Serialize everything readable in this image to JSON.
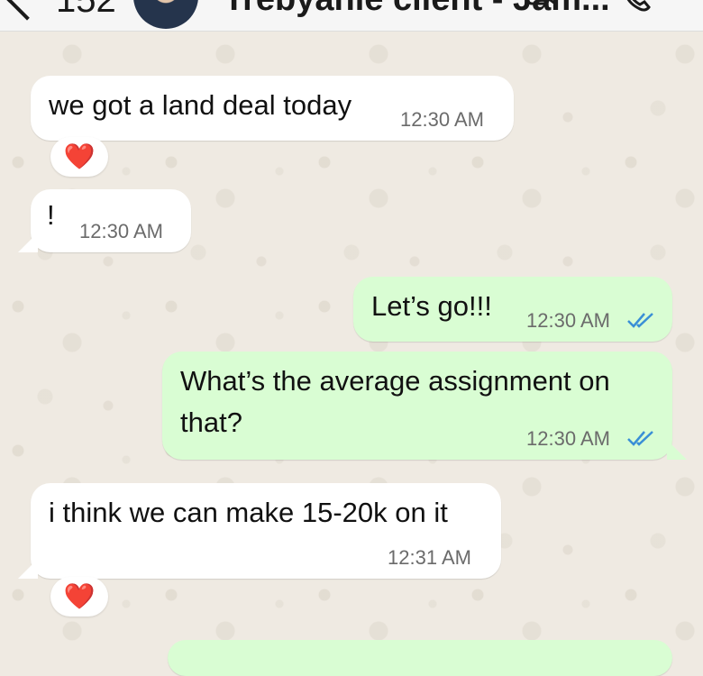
{
  "header": {
    "back_count": "152",
    "contact_name": "Trebyanie client - Jam..."
  },
  "messages": [
    {
      "direction": "incoming",
      "text": "we got a land deal today",
      "time": "12:30 AM",
      "reaction": "❤️"
    },
    {
      "direction": "incoming",
      "text": "!",
      "time": "12:30 AM"
    },
    {
      "direction": "outgoing",
      "text": "Let’s go!!!",
      "time": "12:30 AM",
      "status": "read"
    },
    {
      "direction": "outgoing",
      "text_lines": [
        "What’s the average assignment on",
        "that?"
      ],
      "time": "12:30 AM",
      "status": "read"
    },
    {
      "direction": "incoming",
      "text": "i think we can make 15-20k on it",
      "time": "12:31 AM",
      "reaction": "❤️"
    }
  ],
  "colors": {
    "wallpaper": "#efeae2",
    "incoming_bubble": "#ffffff",
    "outgoing_bubble": "#d9fdd3",
    "read_ticks": "#3a8fd6",
    "heart": "#e0202e"
  },
  "icons": [
    "back-chevron-icon",
    "video-call-icon",
    "phone-call-icon",
    "double-check-icon",
    "heart-reaction-icon"
  ]
}
